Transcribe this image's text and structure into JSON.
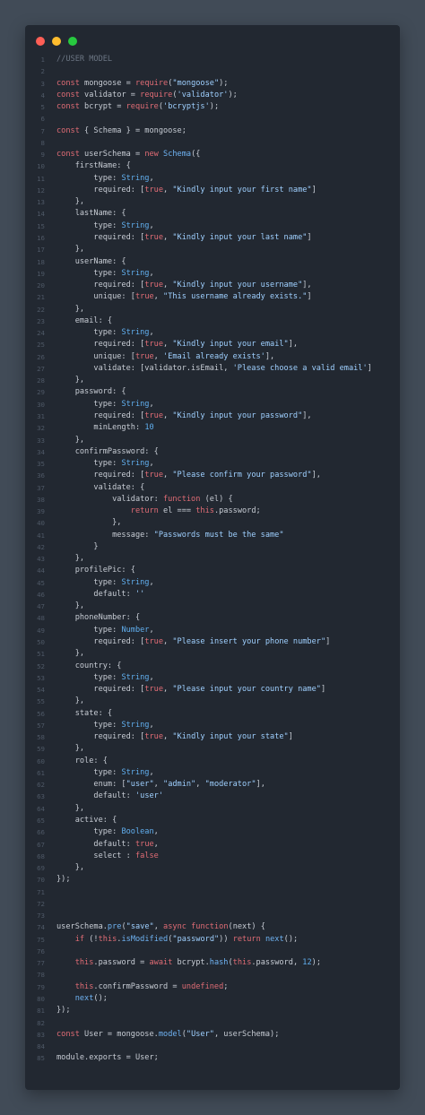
{
  "window": {
    "controls": [
      "close",
      "minimize",
      "maximize"
    ],
    "colors": {
      "close": "#ff5f56",
      "minimize": "#ffbd2e",
      "maximize": "#27c93f",
      "background": "#222831",
      "page": "#414b57"
    }
  },
  "code_lines": [
    "//USER MODEL",
    "",
    "const mongoose = require(\"mongoose\");",
    "const validator = require('validator');",
    "const bcrypt = require('bcryptjs');",
    "",
    "const { Schema } = mongoose;",
    "",
    "const userSchema = new Schema({",
    "    firstName: {",
    "        type: String,",
    "        required: [true, \"Kindly input your first name\"]",
    "    },",
    "    lastName: {",
    "        type: String,",
    "        required: [true, \"Kindly input your last name\"]",
    "    },",
    "    userName: {",
    "        type: String,",
    "        required: [true, \"Kindly input your username\"],",
    "        unique: [true, \"This username already exists.\"]",
    "    },",
    "    email: {",
    "        type: String,",
    "        required: [true, \"Kindly input your email\"],",
    "        unique: [true, 'Email already exists'],",
    "        validate: [validator.isEmail, 'Please choose a valid email']",
    "    },",
    "    password: {",
    "        type: String,",
    "        required: [true, \"Kindly input your password\"],",
    "        minLength: 10",
    "    },",
    "    confirmPassword: {",
    "        type: String,",
    "        required: [true, \"Please confirm your password\"],",
    "        validate: {",
    "            validator: function (el) {",
    "                return el === this.password;",
    "            },",
    "            message: \"Passwords must be the same\"",
    "        }",
    "    },",
    "    profilePic: {",
    "        type: String,",
    "        default: ''",
    "    },",
    "    phoneNumber: {",
    "        type: Number,",
    "        required: [true, \"Please insert your phone number\"]",
    "    },",
    "    country: {",
    "        type: String,",
    "        required: [true, \"Please input your country name\"]",
    "    },",
    "    state: {",
    "        type: String,",
    "        required: [true, \"Kindly input your state\"]",
    "    },",
    "    role: {",
    "        type: String,",
    "        enum: [\"user\", \"admin\", \"moderator\"],",
    "        default: 'user'",
    "    },",
    "    active: {",
    "        type: Boolean,",
    "        default: true,",
    "        select : false",
    "    },",
    "});",
    "",
    "",
    "",
    "userSchema.pre(\"save\", async function(next) {",
    "    if (!this.isModified(\"password\")) return next();",
    "",
    "    this.password = await bcrypt.hash(this.password, 12);",
    "",
    "    this.confirmPassword = undefined;",
    "    next();",
    "});",
    "",
    "const User = mongoose.model(\"User\", userSchema);",
    "",
    "module.exports = User;"
  ]
}
